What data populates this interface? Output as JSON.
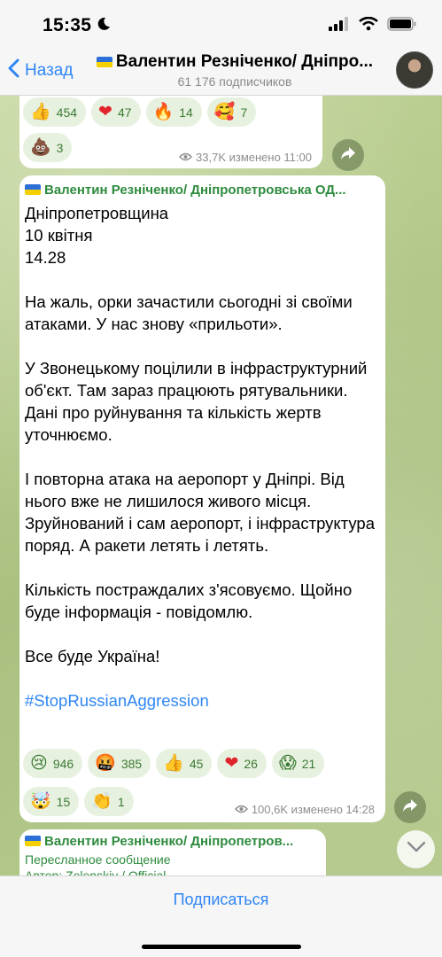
{
  "status": {
    "time": "15:35"
  },
  "header": {
    "back_label": "Назад",
    "title": "Валентин Резніченко/ Дніпро...",
    "subtitle": "61 176 подписчиков"
  },
  "message1": {
    "reactions": [
      {
        "emoji": "👍",
        "count": "454"
      },
      {
        "emoji": "❤",
        "count": "47"
      },
      {
        "emoji": "🔥",
        "count": "14"
      },
      {
        "emoji": "🥰",
        "count": "7"
      },
      {
        "emoji": "💩",
        "count": "3"
      }
    ],
    "meta": "33,7K изменено 11:00"
  },
  "message2": {
    "sender": "Валентин Резніченко/ Дніпропетровська ОД...",
    "lines": [
      "Дніпропетровщина",
      "10 квітня",
      "14.28"
    ],
    "paragraphs": [
      "На жаль, орки зачастили сьогодні зі своїми атаками. У нас знову «прильоти».",
      "У Звонецькому поцілили в інфраструктурний об'єкт. Там зараз працюють рятувальники. Дані про руйнування та кількість жертв уточнюємо.",
      "І повторна атака на аеропорт у  Дніпрі. Від нього вже не лишилося живого місця. Зруйнований і сам аеропорт, і інфраструктура поряд. А ракети летять і летять.",
      "Кількість постраждалих з'ясовуємо. Щойно буде інформація - повідомлю.",
      "Все буде Україна!"
    ],
    "hashtag": "#StopRussianAggression",
    "reactions": [
      {
        "emoji": "😢",
        "count": "946"
      },
      {
        "emoji": "🤬",
        "count": "385"
      },
      {
        "emoji": "👍",
        "count": "45"
      },
      {
        "emoji": "❤",
        "count": "26"
      },
      {
        "emoji": "😱",
        "count": "21"
      },
      {
        "emoji": "🤯",
        "count": "15"
      },
      {
        "emoji": "👏",
        "count": "1"
      }
    ],
    "meta": "100,6K изменено 14:28"
  },
  "message3": {
    "sender": "Валентин Резніченко/ Дніпропетров...",
    "forward_label": "Пересланное сообщение",
    "forward_author": "Автор: Zelenskiy / Official"
  },
  "bottom": {
    "subscribe_label": "Подписаться"
  },
  "colors": {
    "accent": "#2f86f6",
    "sender": "#2e8b3e",
    "reaction_bg": "#e7f1e0",
    "wallpaper": "#b7cc8f"
  }
}
